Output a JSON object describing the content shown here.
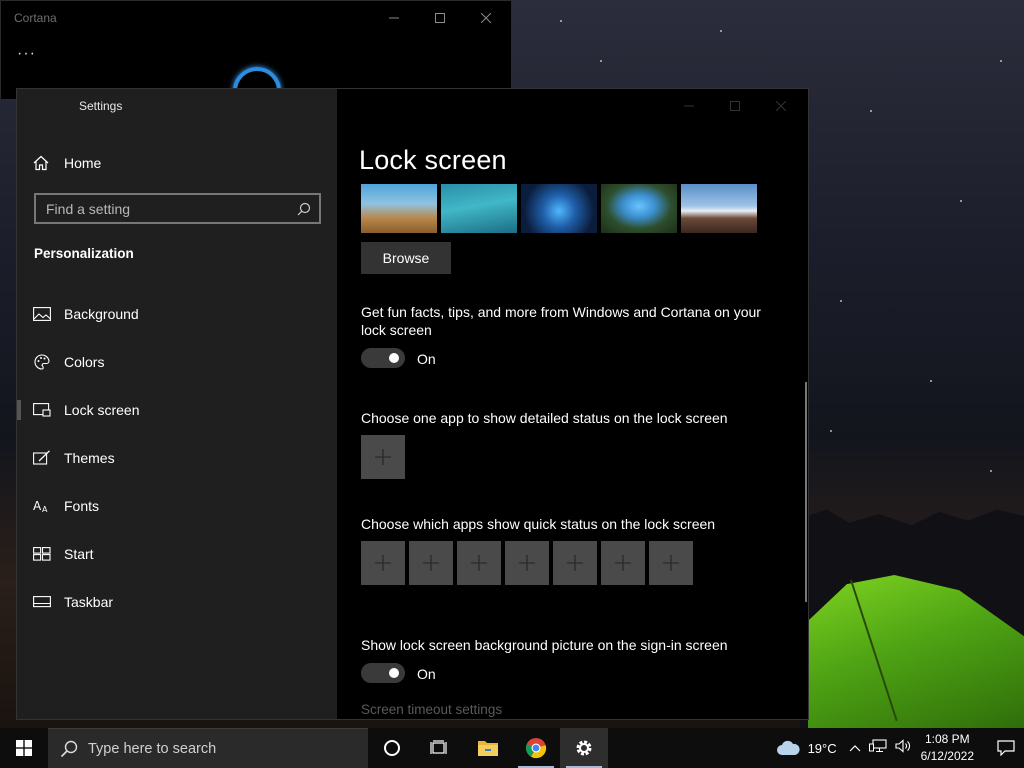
{
  "cortana": {
    "title": "Cortana",
    "menu": "···"
  },
  "settings": {
    "window_title": "Settings",
    "home_label": "Home",
    "search": {
      "placeholder": "Find a setting"
    },
    "section_heading": "Personalization",
    "nav_items": [
      {
        "label": "Background",
        "icon": "image-icon"
      },
      {
        "label": "Colors",
        "icon": "palette-icon"
      },
      {
        "label": "Lock screen",
        "icon": "lock-screen-icon",
        "selected": true
      },
      {
        "label": "Themes",
        "icon": "themes-icon"
      },
      {
        "label": "Fonts",
        "icon": "fonts-icon"
      },
      {
        "label": "Start",
        "icon": "start-icon"
      },
      {
        "label": "Taskbar",
        "icon": "taskbar-icon"
      }
    ],
    "page_title": "Lock screen",
    "browse_label": "Browse",
    "fun_facts": {
      "text": "Get fun facts, tips, and more from Windows and Cortana on your lock screen",
      "toggle_state": "On"
    },
    "detailed_status": {
      "text": "Choose one app to show detailed status on the lock screen"
    },
    "quick_status": {
      "text": "Choose which apps show quick status on the lock screen",
      "slots": 7
    },
    "signin_bg": {
      "text": "Show lock screen background picture on the sign-in screen",
      "toggle_state": "On"
    },
    "timeout_link": "Screen timeout settings"
  },
  "taskbar": {
    "search_placeholder": "Type here to search",
    "weather": "19°C",
    "time": "1:08 PM",
    "date": "6/12/2022"
  },
  "colors": {
    "accent": "#0078d7",
    "nav_bg": "#1f1f1f",
    "content_bg": "#000000",
    "taskbar_bg": "#0d0d0d"
  }
}
